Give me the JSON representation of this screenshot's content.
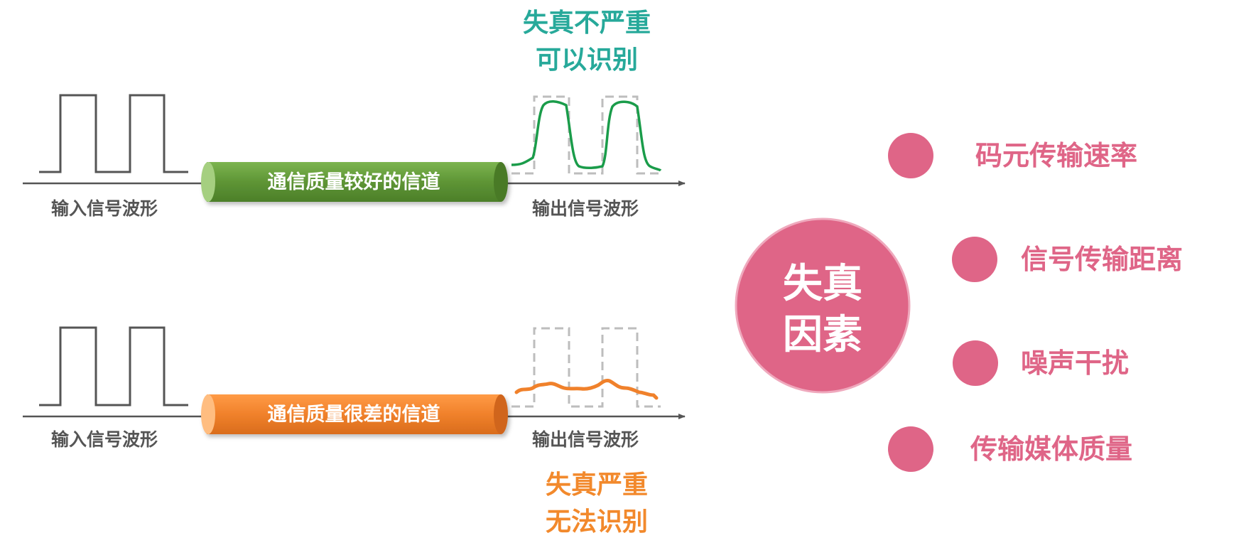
{
  "top_row": {
    "channel_label": "通信质量较好的信道",
    "input_label": "输入信号波形",
    "output_label": "输出信号波形",
    "result_line1": "失真不严重",
    "result_line2": "可以识别",
    "channel_color": "#6a9f3e",
    "wave_color": "#1a9c4a",
    "result_color": "#27a99a"
  },
  "bottom_row": {
    "channel_label": "通信质量很差的信道",
    "input_label": "输入信号波形",
    "output_label": "输出信号波形",
    "result_line1": "失真严重",
    "result_line2": "无法识别",
    "channel_color": "#f0812b",
    "wave_color": "#f0812b",
    "result_color": "#f2892c"
  },
  "factors": {
    "center_line1": "失真",
    "center_line2": "因素",
    "color": "#df6587",
    "items": [
      "码元传输速率",
      "信号传输距离",
      "噪声干扰",
      "传输媒体质量"
    ]
  }
}
